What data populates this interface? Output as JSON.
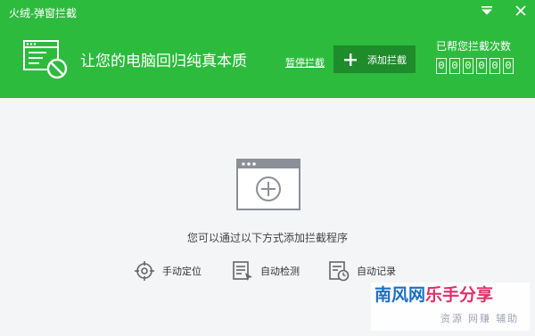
{
  "window": {
    "title": "火绒-弹窗拦截"
  },
  "header": {
    "slogan": "让您的电脑回归纯真本质",
    "pause_label": "暂停拦截",
    "add_label": "添加拦截",
    "count_label": "已帮您拦截次数",
    "count_digits": [
      "0",
      "0",
      "0",
      "0",
      "0",
      "0"
    ]
  },
  "main": {
    "empty_message": "您可以通过以下方式添加拦截程序",
    "actions": [
      {
        "label": "手动定位",
        "icon": "crosshair-icon"
      },
      {
        "label": "自动检测",
        "icon": "scan-list-icon"
      },
      {
        "label": "自动记录",
        "icon": "record-clock-icon"
      }
    ]
  },
  "watermark": {
    "part1": "南风网",
    "part2": "乐手分享",
    "subtitle": "资源 网赚 辅助"
  },
  "colors": {
    "header_green": "#2dbb3d",
    "button_green": "#1f8c2c",
    "background": "#f4f5f7",
    "icon_gray": "#8a8f98"
  }
}
